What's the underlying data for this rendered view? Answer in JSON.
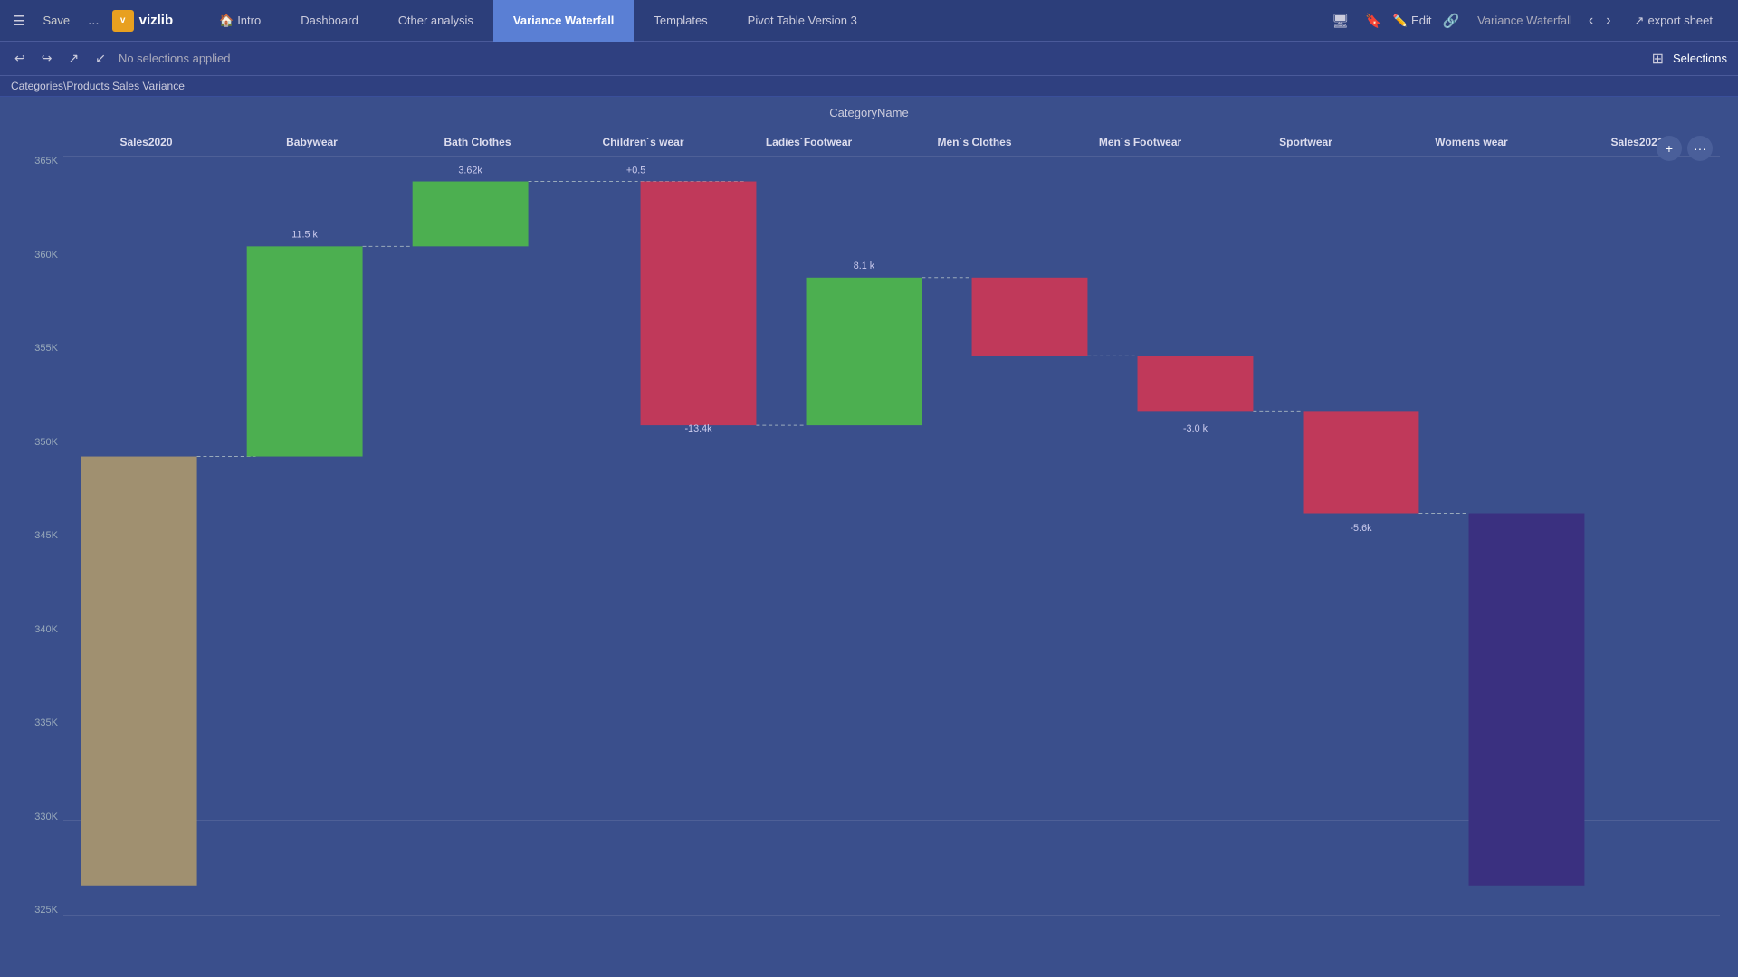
{
  "app": {
    "logo_icon": "v",
    "logo_text": "vizlib"
  },
  "nav": {
    "hamburger": "☰",
    "save_label": "Save",
    "more_label": "...",
    "links": [
      {
        "id": "intro",
        "label": "Intro",
        "icon": "🏠",
        "active": false
      },
      {
        "id": "dashboard",
        "label": "Dashboard",
        "active": false
      },
      {
        "id": "other-analysis",
        "label": "Other analysis",
        "active": false
      },
      {
        "id": "variance-waterfall",
        "label": "Variance Waterfall",
        "active": true
      },
      {
        "id": "templates",
        "label": "Templates",
        "active": false
      },
      {
        "id": "pivot-table",
        "label": "Pivot Table Version 3",
        "active": false
      }
    ],
    "right_icons": [
      "🖥",
      "🔖"
    ],
    "edit_label": "Edit",
    "edit_icon": "✏️",
    "breadcrumb_label": "Variance Waterfall",
    "arrow_left": "‹",
    "arrow_right": "›",
    "export_label": "export sheet",
    "export_icon": "↗"
  },
  "toolbar": {
    "icons": [
      "⟲",
      "⟳",
      "↗",
      "↙"
    ],
    "selection_text": "No selections applied",
    "selections_label": "Selections",
    "grid_icon": "⊞"
  },
  "breadcrumb": {
    "path": "Categories\\Products Sales Variance"
  },
  "chart": {
    "category_name": "CategoryName",
    "y_labels": [
      "365K",
      "360K",
      "355K",
      "350K",
      "345K",
      "340K",
      "335K",
      "330K",
      "325K"
    ],
    "columns": [
      {
        "id": "sales2020",
        "label": "Sales2020"
      },
      {
        "id": "babywear",
        "label": "Babywear"
      },
      {
        "id": "bath-clothes",
        "label": "Bath Clothes"
      },
      {
        "id": "childrens-wear",
        "label": "Children´s wear"
      },
      {
        "id": "ladies-footwear",
        "label": "Ladies´Footwear"
      },
      {
        "id": "mens-clothes",
        "label": "Men´s Clothes"
      },
      {
        "id": "mens-footwear",
        "label": "Men´s Footwear"
      },
      {
        "id": "sportwear",
        "label": "Sportwear"
      },
      {
        "id": "womens-wear",
        "label": "Womens wear"
      },
      {
        "id": "sales2021",
        "label": "Sales2021"
      }
    ],
    "bars": [
      {
        "col": 0,
        "type": "base",
        "color": "#a09070",
        "y_start_pct": 43,
        "height_pct": 57,
        "label": ""
      },
      {
        "col": 1,
        "type": "positive",
        "color": "#4caf50",
        "y_start_pct": 12,
        "height_pct": 31,
        "label": "11.5 k"
      },
      {
        "col": 2,
        "type": "positive",
        "color": "#4caf50",
        "y_start_pct": 3,
        "height_pct": 9,
        "label": "3.62k"
      },
      {
        "col": 3,
        "type": "float",
        "color": "none",
        "y_start_pct": 3,
        "height_pct": 1,
        "label": "+0.5"
      },
      {
        "col": 4,
        "type": "negative",
        "color": "#c0395a",
        "y_start_pct": 3,
        "height_pct": 37,
        "label": "-13.4k"
      },
      {
        "col": 5,
        "type": "positive",
        "color": "#4caf50",
        "y_start_pct": 9,
        "height_pct": 24,
        "label": "8.1 k"
      },
      {
        "col": 6,
        "type": "negative",
        "color": "#c0395a",
        "y_start_pct": 9,
        "height_pct": 25,
        "label": ""
      },
      {
        "col": 7,
        "type": "negative",
        "color": "#c0395a",
        "y_start_pct": 30,
        "height_pct": 12,
        "label": "-3.0 k"
      },
      {
        "col": 8,
        "type": "negative",
        "color": "#c0395a",
        "y_start_pct": 42,
        "height_pct": 18,
        "label": "-5.6k"
      },
      {
        "col": 9,
        "type": "final",
        "color": "#3a3080",
        "y_start_pct": 60,
        "height_pct": 40,
        "label": ""
      }
    ]
  },
  "float_buttons": [
    "+",
    "..."
  ]
}
